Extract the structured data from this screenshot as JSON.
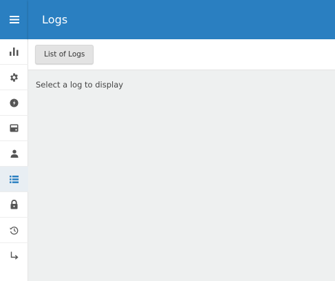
{
  "header": {
    "title": "Logs",
    "color": "#2a7fc1"
  },
  "sidebar": {
    "menu_icon": "hamburger-menu-icon",
    "items": [
      {
        "name": "stats",
        "icon": "bar-chart-icon",
        "active": false
      },
      {
        "name": "settings",
        "icon": "gear-icon",
        "active": false
      },
      {
        "name": "performance",
        "icon": "gauge-icon",
        "active": false
      },
      {
        "name": "storage",
        "icon": "drive-icon",
        "active": false
      },
      {
        "name": "users",
        "icon": "user-icon",
        "active": false
      },
      {
        "name": "logs",
        "icon": "list-icon",
        "active": true
      },
      {
        "name": "security",
        "icon": "lock-icon",
        "active": false
      },
      {
        "name": "history",
        "icon": "history-icon",
        "active": false
      },
      {
        "name": "logout",
        "icon": "exit-arrow-icon",
        "active": false
      }
    ],
    "active_color": "#2a7fc1",
    "icon_color": "#555555"
  },
  "toolbar": {
    "list_logs_label": "List of Logs"
  },
  "main": {
    "empty_message": "Select a log to display"
  }
}
